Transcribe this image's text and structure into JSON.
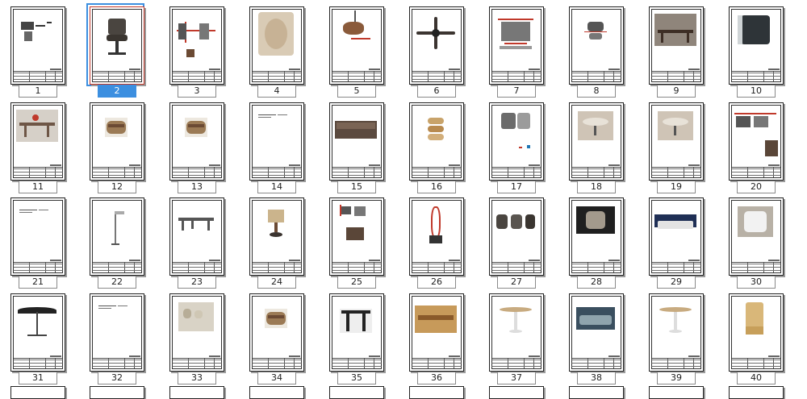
{
  "selected_page": "2",
  "pages": [
    {
      "label": "1",
      "thumb": "technical-drawing"
    },
    {
      "label": "2",
      "thumb": "office-chair-photo"
    },
    {
      "label": "3",
      "thumb": "elevation-drawing"
    },
    {
      "label": "4",
      "thumb": "leaf-pattern"
    },
    {
      "label": "5",
      "thumb": "pendant-lamp"
    },
    {
      "label": "6",
      "thumb": "ceiling-fan"
    },
    {
      "label": "7",
      "thumb": "dimension-drawing"
    },
    {
      "label": "8",
      "thumb": "fixture-drawing"
    },
    {
      "label": "9",
      "thumb": "dining-table-photo"
    },
    {
      "label": "10",
      "thumb": "armchair-photo"
    },
    {
      "label": "11",
      "thumb": "table-photo"
    },
    {
      "label": "12",
      "thumb": "stool-photo"
    },
    {
      "label": "13",
      "thumb": "stool-photo"
    },
    {
      "label": "14",
      "thumb": "text-only"
    },
    {
      "label": "15",
      "thumb": "sofa-photo"
    },
    {
      "label": "16",
      "thumb": "stacked-stool"
    },
    {
      "label": "17",
      "thumb": "chair-drawing"
    },
    {
      "label": "18",
      "thumb": "side-table-photo"
    },
    {
      "label": "19",
      "thumb": "side-table-photo"
    },
    {
      "label": "20",
      "thumb": "cabinet-drawing"
    },
    {
      "label": "21",
      "thumb": "text-only"
    },
    {
      "label": "22",
      "thumb": "floor-lamp"
    },
    {
      "label": "23",
      "thumb": "bench-photo"
    },
    {
      "label": "24",
      "thumb": "table-lamp"
    },
    {
      "label": "25",
      "thumb": "detail-drawing"
    },
    {
      "label": "26",
      "thumb": "mirror-drawing"
    },
    {
      "label": "27",
      "thumb": "chairs-photo"
    },
    {
      "label": "28",
      "thumb": "lounge-chair-photo"
    },
    {
      "label": "29",
      "thumb": "sofa-blue-photo"
    },
    {
      "label": "30",
      "thumb": "armchair-white-photo"
    },
    {
      "label": "31",
      "thumb": "umbrella-photo"
    },
    {
      "label": "32",
      "thumb": "text-only"
    },
    {
      "label": "33",
      "thumb": "glassware-photo"
    },
    {
      "label": "34",
      "thumb": "stool-photo"
    },
    {
      "label": "35",
      "thumb": "x-table-photo"
    },
    {
      "label": "36",
      "thumb": "dining-set-photo"
    },
    {
      "label": "37",
      "thumb": "round-table-photo"
    },
    {
      "label": "38",
      "thumb": "outdoor-sofa-photo"
    },
    {
      "label": "39",
      "thumb": "round-table-photo"
    },
    {
      "label": "40",
      "thumb": "wood-chair-photo"
    }
  ]
}
